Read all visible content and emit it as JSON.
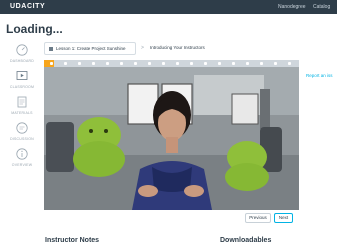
{
  "header": {
    "brand": "UDACITY",
    "links": [
      "Nanodegree",
      "Catalog"
    ]
  },
  "page": {
    "title": "Loading..."
  },
  "sidebar": {
    "items": [
      {
        "label": "DASHBOARD",
        "icon": "dashboard-icon"
      },
      {
        "label": "CLASSROOM",
        "icon": "classroom-icon"
      },
      {
        "label": "MATERIALS",
        "icon": "materials-icon"
      },
      {
        "label": "DISCUSSION",
        "icon": "discussion-icon"
      },
      {
        "label": "OVERVIEW",
        "icon": "overview-icon"
      }
    ]
  },
  "breadcrumb": {
    "lesson": "Lesson 1: Create Project Sunshine",
    "separator": ">",
    "concept": "Introducing Your Instructors"
  },
  "video": {
    "progress_fraction": 0.04
  },
  "links": {
    "report": "Report an iss"
  },
  "nav": {
    "previous": "Previous",
    "next": "Next"
  },
  "sections": {
    "notes": "Instructor Notes",
    "downloads": "Downloadables"
  },
  "colors": {
    "topbar": "#2e3d49",
    "accent": "#02b3e4",
    "progress": "#f7a51c"
  }
}
